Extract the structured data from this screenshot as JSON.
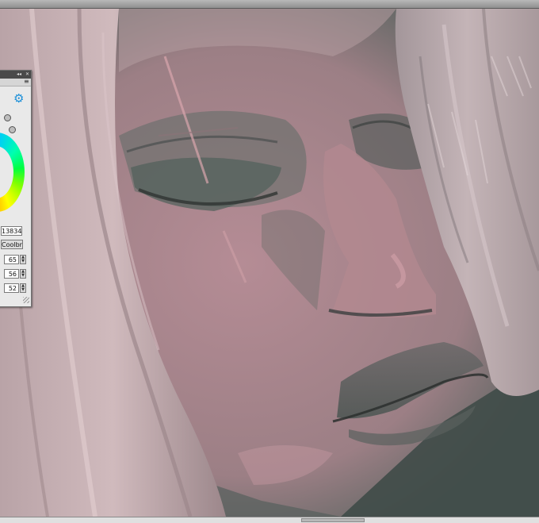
{
  "window": {
    "title_buttons": [
      "◂◂",
      "✕"
    ],
    "menu_glyph": "≡"
  },
  "color_panel": {
    "icons": [
      "gear-icon",
      "eyedropper-icon",
      "swap-icon"
    ],
    "value_display": "13834",
    "brush_button": "Coolbrus!",
    "channels": [
      {
        "value": "65"
      },
      {
        "value": "56"
      },
      {
        "value": "52"
      }
    ]
  },
  "colors": {
    "canvas_skin": "#a88a8f",
    "shadow_teal": "#4f5c58",
    "hair_light": "#c7b0b3",
    "accent_blue": "#1a8fd8"
  }
}
